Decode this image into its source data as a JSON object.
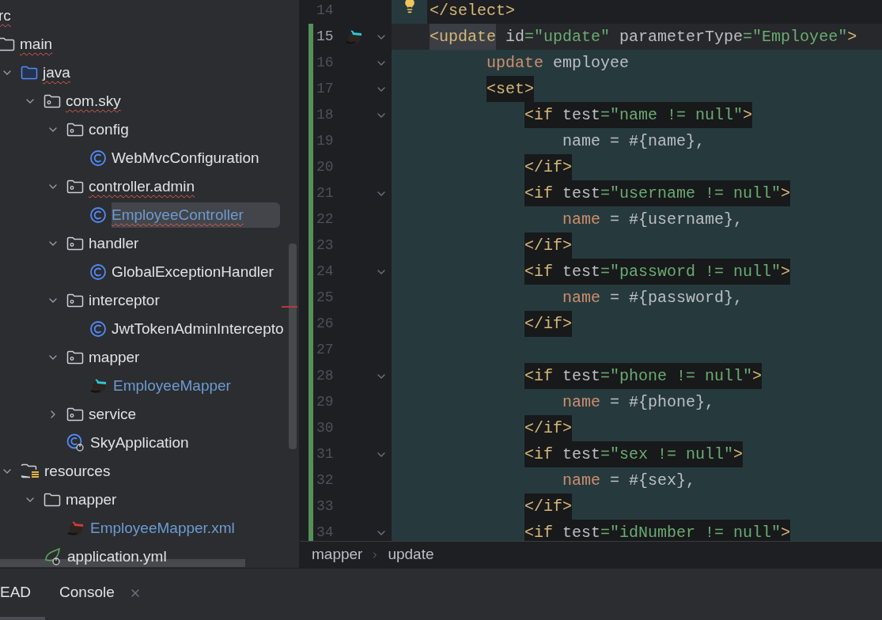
{
  "project_tree": [
    {
      "label": "rc",
      "error": true,
      "children": [
        {
          "label": "main",
          "kind": "folder",
          "error": true,
          "modified": false,
          "selected": false,
          "children": [
            {
              "label": "java",
              "kind": "source_folder",
              "error": true,
              "modified": false,
              "selected": false,
              "expanded": true,
              "children": [
                {
                  "label": "com.sky",
                  "kind": "package",
                  "error": true,
                  "modified": false,
                  "selected": false,
                  "expanded": true,
                  "children": [
                    {
                      "label": "config",
                      "kind": "package",
                      "error": false,
                      "modified": false,
                      "selected": false,
                      "expanded": true,
                      "children": [
                        {
                          "label": "WebMvcConfiguration",
                          "kind": "class",
                          "error": false,
                          "modified": false,
                          "selected": false
                        }
                      ]
                    },
                    {
                      "label": "controller.admin",
                      "kind": "package",
                      "error": true,
                      "modified": false,
                      "selected": false,
                      "expanded": true,
                      "children": [
                        {
                          "label": "EmployeeController",
                          "kind": "class",
                          "error": true,
                          "modified": true,
                          "selected": true
                        }
                      ]
                    },
                    {
                      "label": "handler",
                      "kind": "package",
                      "error": false,
                      "modified": false,
                      "selected": false,
                      "expanded": true,
                      "children": [
                        {
                          "label": "GlobalExceptionHandler",
                          "kind": "class",
                          "error": false,
                          "modified": false,
                          "selected": false
                        }
                      ]
                    },
                    {
                      "label": "interceptor",
                      "kind": "package",
                      "error": false,
                      "modified": false,
                      "selected": false,
                      "expanded": true,
                      "children": [
                        {
                          "label": "JwtTokenAdminIntercepto",
                          "kind": "class",
                          "error": false,
                          "modified": false,
                          "selected": false
                        }
                      ]
                    },
                    {
                      "label": "mapper",
                      "kind": "package",
                      "error": false,
                      "modified": false,
                      "selected": false,
                      "expanded": true,
                      "children": [
                        {
                          "label": "EmployeeMapper",
                          "kind": "mapper_java",
                          "error": false,
                          "modified": true,
                          "selected": false
                        }
                      ]
                    },
                    {
                      "label": "service",
                      "kind": "package",
                      "error": false,
                      "modified": false,
                      "selected": false,
                      "expanded": false
                    },
                    {
                      "label": "SkyApplication",
                      "kind": "spring_class",
                      "error": false,
                      "modified": false,
                      "selected": false
                    }
                  ]
                }
              ]
            },
            {
              "label": "resources",
              "kind": "resources",
              "error": false,
              "modified": false,
              "selected": false,
              "expanded": true,
              "children": [
                {
                  "label": "mapper",
                  "kind": "folder",
                  "error": false,
                  "modified": false,
                  "selected": false,
                  "expanded": true,
                  "children": [
                    {
                      "label": "EmployeeMapper.xml",
                      "kind": "mapper_xml",
                      "error": false,
                      "modified": true,
                      "selected": false
                    }
                  ]
                },
                {
                  "label": "application.yml",
                  "kind": "yaml",
                  "error": false,
                  "modified": false,
                  "selected": false
                }
              ]
            }
          ]
        }
      ]
    }
  ],
  "editor": {
    "lines": [
      {
        "number": "14",
        "kind": "bulb",
        "fold": false,
        "current": false,
        "tokens": [
          {
            "text": "    </select>",
            "kind": "tag"
          }
        ]
      },
      {
        "number": "15",
        "kind": "mapper",
        "fold": true,
        "current": true,
        "boxed": false,
        "tokens": [
          {
            "text": "    <update",
            "kind": "tag_matched"
          },
          {
            "text": " id",
            "kind": "attr"
          },
          {
            "text": "=\"update\"",
            "kind": "string"
          },
          {
            "text": " parameterType",
            "kind": "attr"
          },
          {
            "text": "=\"Employee\"",
            "kind": "string"
          },
          {
            "text": ">",
            "kind": "tag"
          }
        ]
      },
      {
        "number": "16",
        "kind": "plain",
        "fold": true,
        "current": false,
        "scope": true,
        "boxed": false,
        "tokens": [
          {
            "text": "          update",
            "kind": "keyword"
          },
          {
            "text": " employee",
            "kind": "text"
          }
        ]
      },
      {
        "number": "17",
        "kind": "plain",
        "fold": true,
        "current": false,
        "scope": true,
        "boxed": true,
        "tokens": [
          {
            "text": "          <set>",
            "kind": "tag"
          }
        ]
      },
      {
        "number": "18",
        "kind": "plain",
        "fold": true,
        "current": false,
        "scope": true,
        "boxed": true,
        "tokens": [
          {
            "text": "              <if",
            "kind": "tag"
          },
          {
            "text": " test",
            "kind": "attr"
          },
          {
            "text": "=\"name != null\"",
            "kind": "string"
          },
          {
            "text": ">",
            "kind": "tag"
          }
        ]
      },
      {
        "number": "19",
        "kind": "plain",
        "fold": false,
        "current": false,
        "scope": true,
        "boxed": false,
        "tokens": [
          {
            "text": "                  name",
            "kind": "text"
          },
          {
            "text": " = #{name},",
            "kind": "text"
          }
        ]
      },
      {
        "number": "20",
        "kind": "plain",
        "fold": false,
        "current": false,
        "scope": true,
        "boxed": true,
        "tokens": [
          {
            "text": "              </if>",
            "kind": "tag"
          }
        ]
      },
      {
        "number": "21",
        "kind": "plain",
        "fold": true,
        "current": false,
        "scope": true,
        "boxed": true,
        "tokens": [
          {
            "text": "              <if",
            "kind": "tag"
          },
          {
            "text": " test",
            "kind": "attr"
          },
          {
            "text": "=\"username != null\"",
            "kind": "string"
          },
          {
            "text": ">",
            "kind": "tag"
          }
        ]
      },
      {
        "number": "22",
        "kind": "plain",
        "fold": false,
        "current": false,
        "scope": true,
        "boxed": false,
        "tokens": [
          {
            "text": "                  name",
            "kind": "column"
          },
          {
            "text": " = #{username},",
            "kind": "text"
          }
        ]
      },
      {
        "number": "23",
        "kind": "plain",
        "fold": false,
        "current": false,
        "scope": true,
        "boxed": true,
        "tokens": [
          {
            "text": "              </if>",
            "kind": "tag"
          }
        ]
      },
      {
        "number": "24",
        "kind": "plain",
        "fold": true,
        "current": false,
        "scope": true,
        "boxed": true,
        "tokens": [
          {
            "text": "              <if",
            "kind": "tag"
          },
          {
            "text": " test",
            "kind": "attr"
          },
          {
            "text": "=\"password != null\"",
            "kind": "string"
          },
          {
            "text": ">",
            "kind": "tag"
          }
        ]
      },
      {
        "number": "25",
        "kind": "plain",
        "fold": false,
        "current": false,
        "scope": true,
        "boxed": false,
        "tokens": [
          {
            "text": "                  name",
            "kind": "column"
          },
          {
            "text": " = #{password},",
            "kind": "text"
          }
        ]
      },
      {
        "number": "26",
        "kind": "plain",
        "fold": false,
        "current": false,
        "scope": true,
        "boxed": true,
        "tokens": [
          {
            "text": "              </if>",
            "kind": "tag"
          }
        ]
      },
      {
        "number": "27",
        "kind": "plain",
        "fold": false,
        "current": false,
        "scope": true
      },
      {
        "number": "28",
        "kind": "plain",
        "fold": true,
        "current": false,
        "scope": true,
        "boxed": true,
        "tokens": [
          {
            "text": "              <if",
            "kind": "tag"
          },
          {
            "text": " test",
            "kind": "attr"
          },
          {
            "text": "=\"phone != null\"",
            "kind": "string"
          },
          {
            "text": ">",
            "kind": "tag"
          }
        ]
      },
      {
        "number": "29",
        "kind": "plain",
        "fold": false,
        "current": false,
        "scope": true,
        "boxed": false,
        "tokens": [
          {
            "text": "                  name",
            "kind": "column"
          },
          {
            "text": " = #{phone},",
            "kind": "text"
          }
        ]
      },
      {
        "number": "30",
        "kind": "plain",
        "fold": false,
        "current": false,
        "scope": true,
        "boxed": true,
        "tokens": [
          {
            "text": "              </if>",
            "kind": "tag"
          }
        ]
      },
      {
        "number": "31",
        "kind": "plain",
        "fold": true,
        "current": false,
        "scope": true,
        "boxed": true,
        "tokens": [
          {
            "text": "              <if",
            "kind": "tag"
          },
          {
            "text": " test",
            "kind": "attr"
          },
          {
            "text": "=\"sex != null\"",
            "kind": "string"
          },
          {
            "text": ">",
            "kind": "tag"
          }
        ]
      },
      {
        "number": "32",
        "kind": "plain",
        "fold": false,
        "current": false,
        "scope": true,
        "boxed": false,
        "tokens": [
          {
            "text": "                  name",
            "kind": "column"
          },
          {
            "text": " = #{sex},",
            "kind": "text"
          }
        ]
      },
      {
        "number": "33",
        "kind": "plain",
        "fold": false,
        "current": false,
        "scope": true,
        "boxed": true,
        "tokens": [
          {
            "text": "              </if>",
            "kind": "tag"
          }
        ]
      },
      {
        "number": "34",
        "kind": "plain",
        "fold": true,
        "current": false,
        "scope": true,
        "boxed": true,
        "tokens": [
          {
            "text": "              <if",
            "kind": "tag"
          },
          {
            "text": " test",
            "kind": "attr"
          },
          {
            "text": "=\"idNumber != null\"",
            "kind": "string"
          },
          {
            "text": ">",
            "kind": "tag"
          }
        ]
      }
    ]
  },
  "breadcrumb": [
    "mapper",
    "update"
  ],
  "bottom_tabs": [
    {
      "label": "EAD",
      "selected": true,
      "closable": false
    },
    {
      "label": "Console",
      "selected": false,
      "closable": true
    }
  ]
}
